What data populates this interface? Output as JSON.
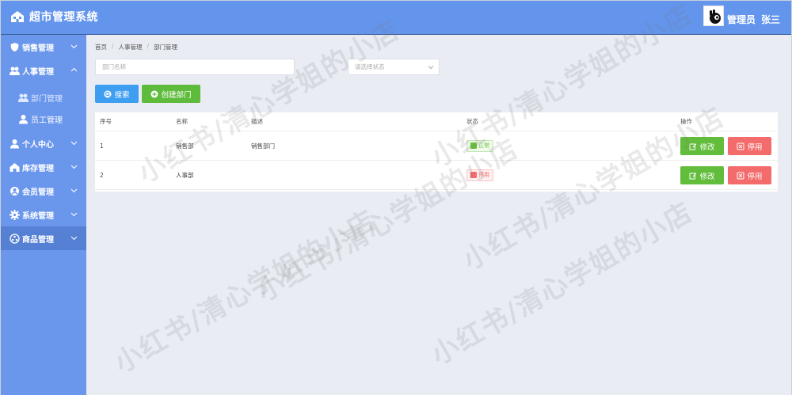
{
  "header": {
    "title": "超市管理系统",
    "user_role": "管理员",
    "user_name": "张三"
  },
  "sidebar": {
    "items": [
      {
        "label": "销售管理",
        "icon": "shield-icon",
        "expanded": false
      },
      {
        "label": "人事管理",
        "icon": "users-icon",
        "expanded": true,
        "children": [
          {
            "label": "部门管理",
            "icon": "department-icon",
            "selected": true
          },
          {
            "label": "员工管理",
            "icon": "user-icon",
            "selected": false
          }
        ]
      },
      {
        "label": "个人中心",
        "icon": "person-icon",
        "expanded": false
      },
      {
        "label": "库存管理",
        "icon": "warehouse-icon",
        "expanded": false
      },
      {
        "label": "会员管理",
        "icon": "member-icon",
        "expanded": false
      },
      {
        "label": "系统管理",
        "icon": "gear-icon",
        "expanded": false
      },
      {
        "label": "商品管理",
        "icon": "goods-icon",
        "expanded": false
      }
    ]
  },
  "breadcrumb": [
    "首页",
    "人事管理",
    "部门管理"
  ],
  "filters": {
    "name_placeholder": "部门名称",
    "status_placeholder": "请选择状态"
  },
  "buttons": {
    "search": "搜索",
    "create": "创建部门"
  },
  "table": {
    "headers": [
      "序号",
      "名称",
      "描述",
      "状态",
      "操作"
    ],
    "rows": [
      {
        "index": "1",
        "name": "销售部",
        "desc": "销售部门",
        "status": "正常",
        "status_type": "ok"
      },
      {
        "index": "2",
        "name": "人事部",
        "desc": "",
        "status": "停用",
        "status_type": "stop"
      }
    ],
    "action_edit": "修改",
    "action_stop": "停用"
  },
  "watermark": "小红书/清心学姐的小店",
  "colors": {
    "header_bg": "#6495ed",
    "sidebar_bg": "#6a96ec",
    "primary": "#3e9ef2",
    "success": "#62bd3c",
    "danger": "#f36b6b"
  }
}
